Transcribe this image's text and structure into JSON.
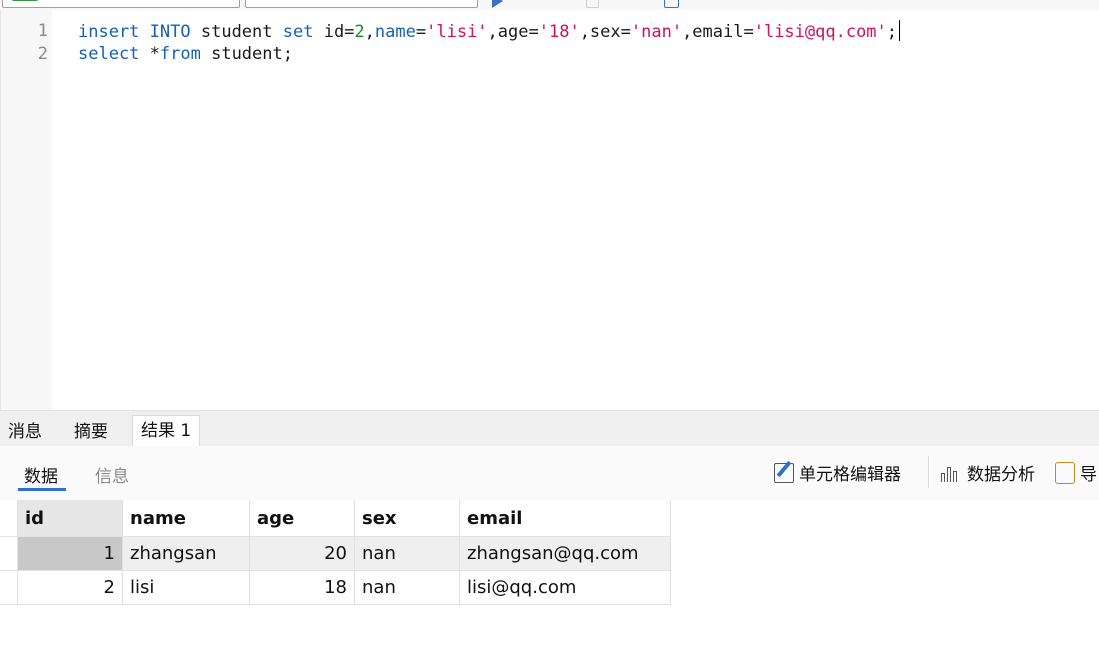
{
  "editor": {
    "line_numbers": [
      "1",
      "2"
    ],
    "line1": {
      "t1": "insert",
      "t2": " ",
      "t3": "INTO",
      "t4": " student ",
      "t5": "set",
      "t6": " id=",
      "t7": "2",
      "t8": ",",
      "t9": "name",
      "t10": "=",
      "t11": "'lisi'",
      "t12": ",age=",
      "t13": "'18'",
      "t14": ",sex=",
      "t15": "'nan'",
      "t16": ",email=",
      "t17": "'lisi@qq.com'",
      "t18": ";"
    },
    "line2": {
      "t1": "select",
      "t2": " *",
      "t3": "from",
      "t4": " student;"
    },
    "colors": {
      "keyword": "#1560b4",
      "number": "#1b8a2e",
      "string": "#d0105e"
    }
  },
  "result_tabs": [
    "消息",
    "摘要",
    "结果 1"
  ],
  "sub_tabs": [
    "数据",
    "信息"
  ],
  "tools": {
    "cell_editor": "单元格编辑器",
    "data_analysis": "数据分析",
    "export": "导"
  },
  "table": {
    "columns": [
      "id",
      "name",
      "age",
      "sex",
      "email"
    ],
    "rows": [
      [
        "1",
        "zhangsan",
        "20",
        "nan",
        "zhangsan@qq.com"
      ],
      [
        "2",
        "lisi",
        "18",
        "nan",
        "lisi@qq.com"
      ]
    ]
  }
}
